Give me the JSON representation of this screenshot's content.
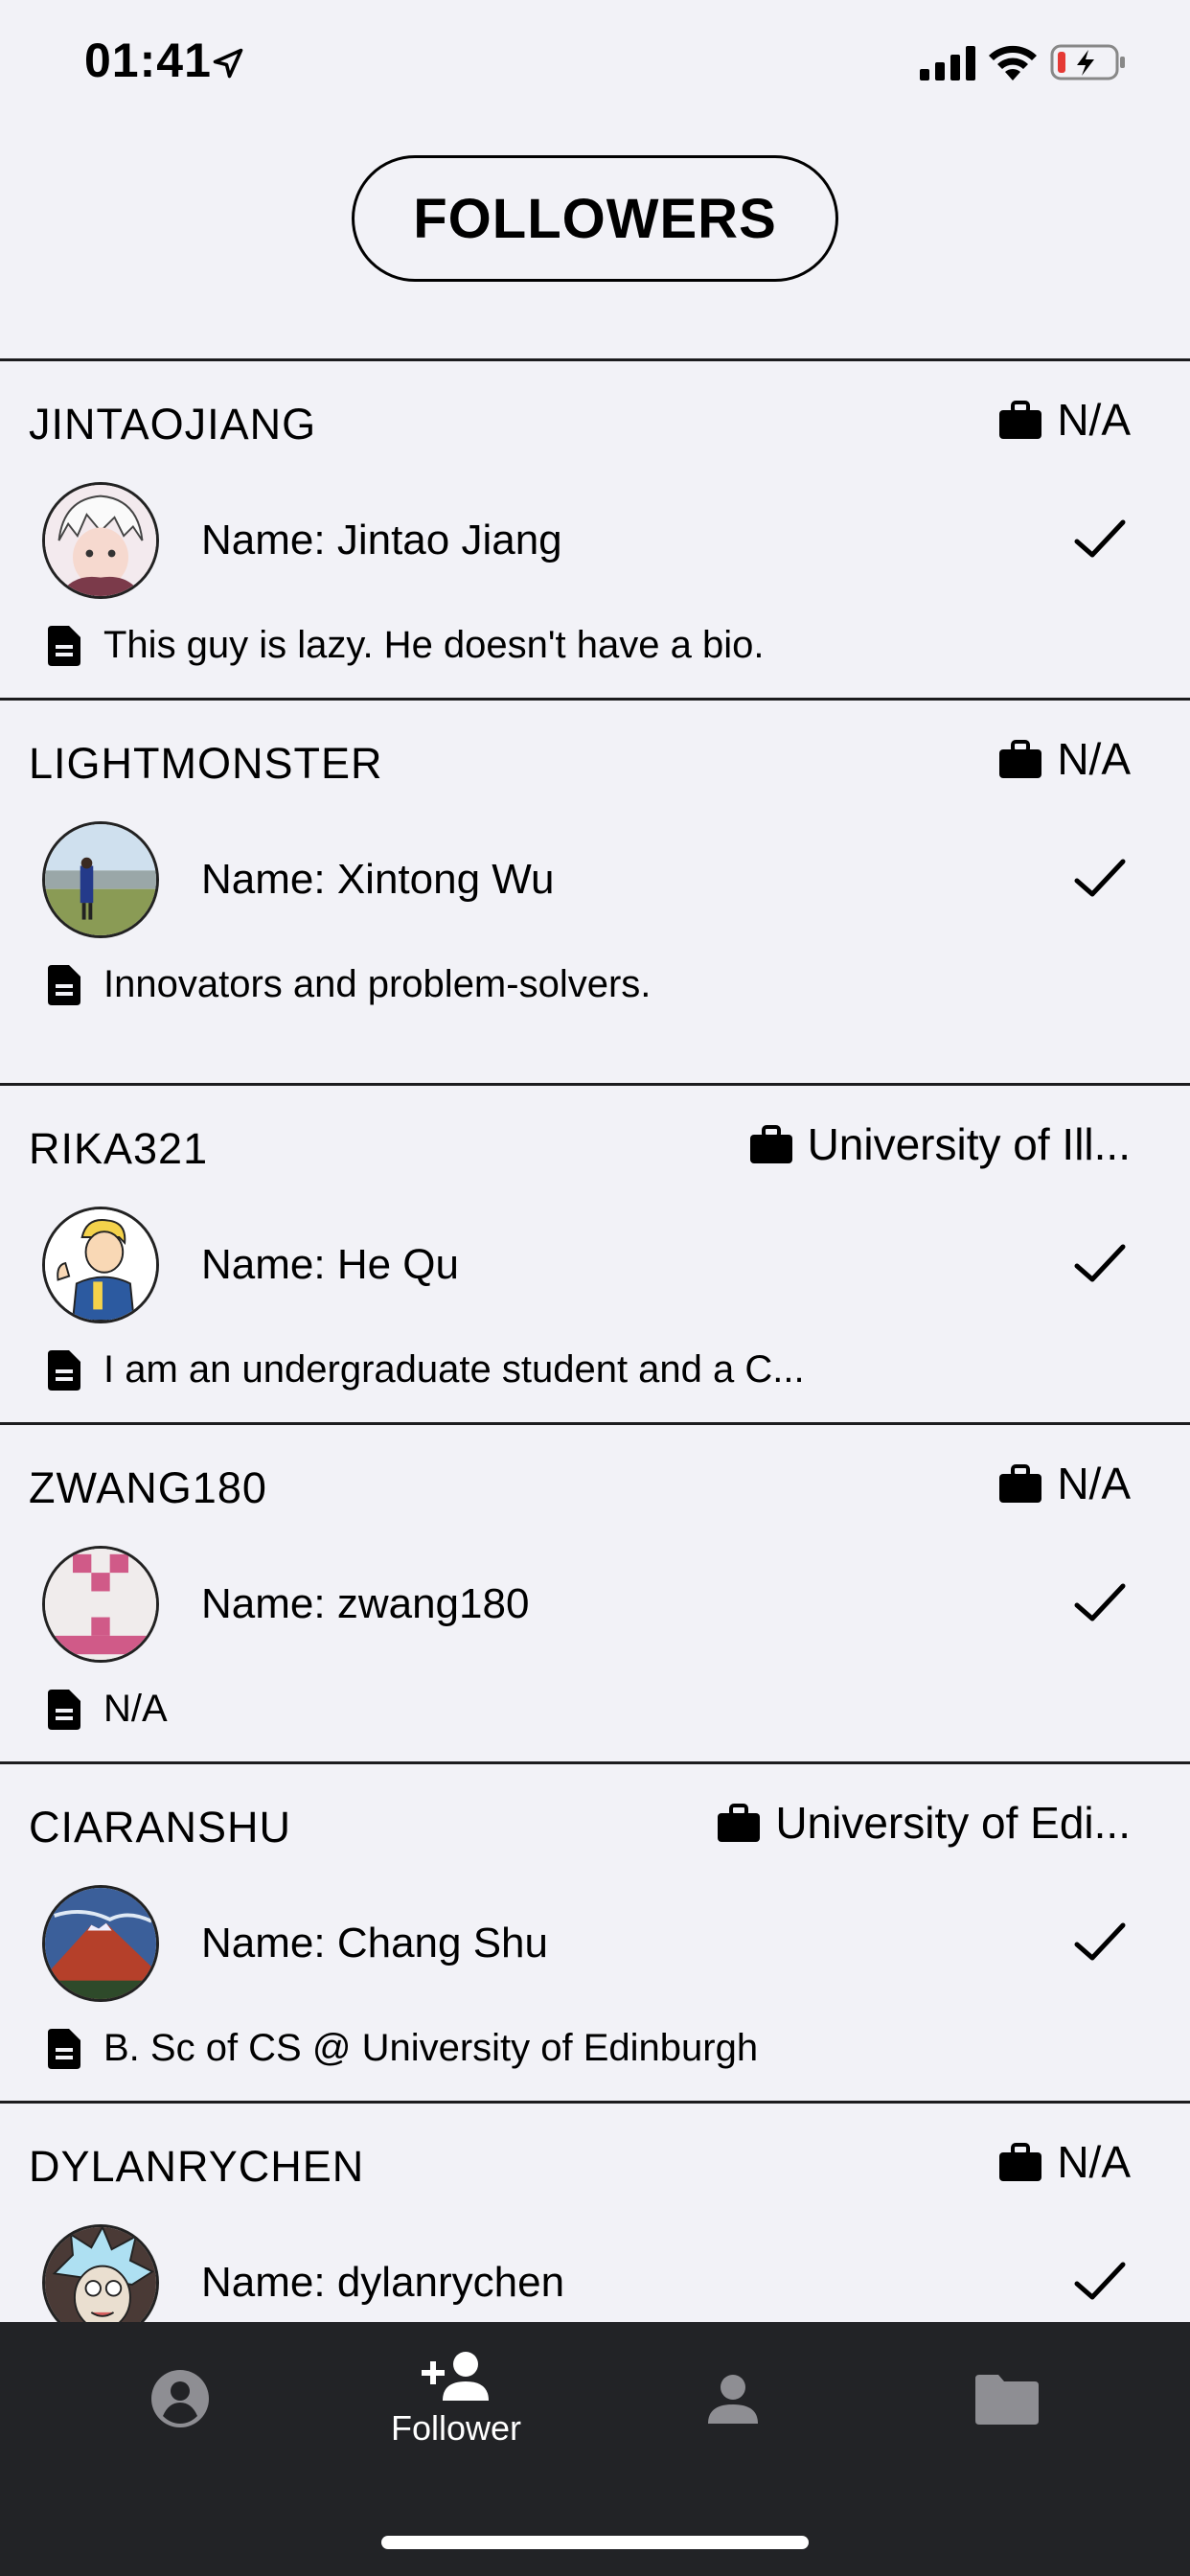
{
  "status_bar": {
    "time": "01:41"
  },
  "header": {
    "title": "FOLLOWERS"
  },
  "followers": [
    {
      "username": "JINTAOJIANG",
      "work": "N/A",
      "name": "Name: Jintao Jiang",
      "bio": "This guy is lazy. He doesn't have a bio.",
      "avatar": "anime-avatar"
    },
    {
      "username": "LIGHTMONSTER",
      "work": "N/A",
      "name": "Name: Xintong Wu",
      "bio": "Innovators and problem-solvers.",
      "avatar": "landscape-photo-avatar"
    },
    {
      "username": "RIKA321",
      "work": "University of Ill...",
      "name": "Name: He Qu",
      "bio": "I am an undergraduate student and a C...",
      "avatar": "cartoon-avatar"
    },
    {
      "username": "ZWANG180",
      "work": "N/A",
      "name": "Name: zwang180",
      "bio": "N/A",
      "avatar": "pixel-identicon-avatar"
    },
    {
      "username": "CIARANSHU",
      "work": "University of Edi...",
      "name": "Name: Chang Shu",
      "bio": "B. Sc of CS @ University of Edinburgh",
      "avatar": "mountain-painting-avatar"
    },
    {
      "username": "DYLANRYCHEN",
      "work": "N/A",
      "name": "Name: dylanrychen",
      "bio": "",
      "avatar": "cartoon-character-avatar"
    }
  ],
  "tabs": [
    {
      "icon": "account-circle-icon",
      "label": "",
      "active": false
    },
    {
      "icon": "person-add-icon",
      "label": "Follower",
      "active": true
    },
    {
      "icon": "person-icon",
      "label": "",
      "active": false
    },
    {
      "icon": "folder-icon",
      "label": "",
      "active": false
    }
  ],
  "colors": {
    "background": "#f2f2f7",
    "tab_bar": "#222326",
    "tab_inactive": "#8e8e93",
    "divider": "#1c1c1e"
  }
}
